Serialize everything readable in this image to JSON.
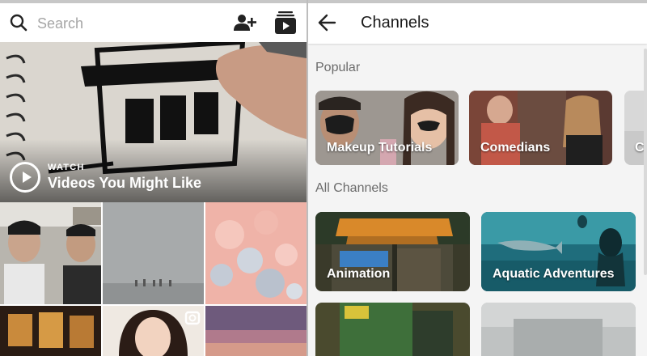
{
  "explore": {
    "search": {
      "placeholder": "Search",
      "value": ""
    },
    "icons": {
      "search": "search-icon",
      "add_friend": "add-person-icon",
      "igtv": "igtv-icon"
    },
    "hero": {
      "kicker": "WATCH",
      "title": "Videos You Might Like",
      "icon": "play-icon"
    }
  },
  "channels": {
    "title": "Channels",
    "back_icon": "back-arrow-icon",
    "popular_label": "Popular",
    "all_label": "All Channels",
    "popular": [
      {
        "label": "Makeup Tutorials"
      },
      {
        "label": "Comedians"
      },
      {
        "label": "Co"
      }
    ],
    "all": [
      {
        "label": "Animation"
      },
      {
        "label": "Aquatic Adventures"
      },
      {
        "label": ""
      },
      {
        "label": ""
      }
    ]
  }
}
